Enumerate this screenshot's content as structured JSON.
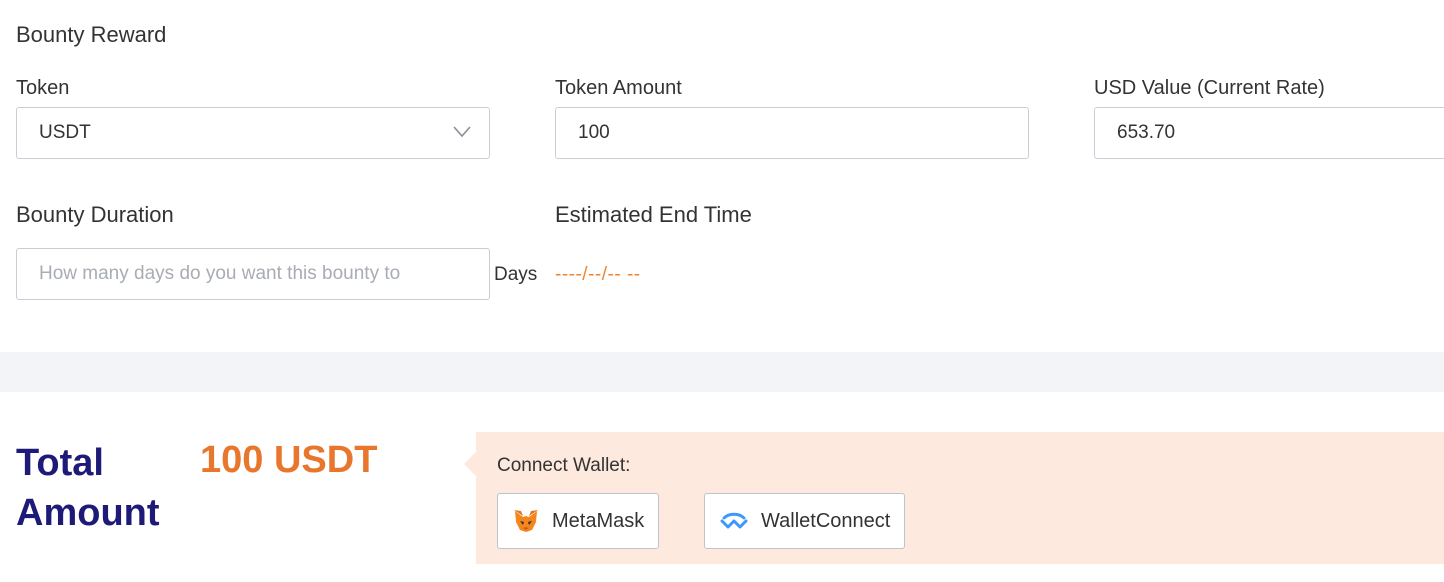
{
  "reward": {
    "section_title": "Bounty Reward",
    "token_label": "Token",
    "token_value": "USDT",
    "amount_label": "Token Amount",
    "amount_value": "100",
    "usd_label": "USD Value (Current Rate)",
    "usd_value": "653.70"
  },
  "duration": {
    "label": "Bounty Duration",
    "placeholder": "How many days do you want this bounty to",
    "suffix": "Days",
    "end_label": "Estimated End Time",
    "end_value": "----/--/-- --"
  },
  "total": {
    "label": "Total Amount",
    "value": "100 USDT"
  },
  "wallet": {
    "title": "Connect Wallet:",
    "options": [
      {
        "label": "MetaMask",
        "icon": "metamask-fox-icon"
      },
      {
        "label": "WalletConnect",
        "icon": "walletconnect-icon"
      }
    ]
  },
  "colors": {
    "accent_orange": "#e8762d",
    "total_navy": "#1e1a78",
    "wallet_panel_bg": "#fde9de"
  }
}
